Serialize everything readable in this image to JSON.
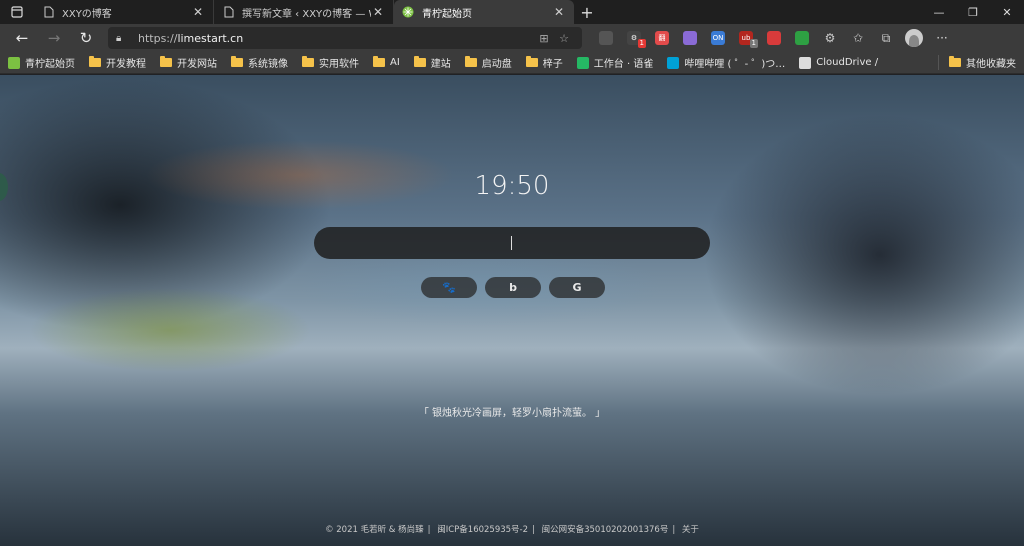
{
  "tabs": [
    {
      "title": "XXYの博客",
      "active": false
    },
    {
      "title": "撰写新文章 ‹ XXYの博客 — Wor…",
      "active": false
    },
    {
      "title": "青柠起始页",
      "active": true
    }
  ],
  "address": {
    "scheme": "https://",
    "host": "limestart.cn"
  },
  "extensions": [
    {
      "name": "reader-icon",
      "color": "#555555",
      "label": "",
      "badge": ""
    },
    {
      "name": "ext-icon-1",
      "color": "#444444",
      "label": "⚙",
      "badge": "1"
    },
    {
      "name": "ext-icon-2",
      "color": "#e24b4b",
      "label": "翻",
      "badge": ""
    },
    {
      "name": "ext-icon-3",
      "color": "#8a6bd6",
      "label": "",
      "badge": ""
    },
    {
      "name": "ext-icon-4",
      "color": "#3a7bd5",
      "label": "ON",
      "badge": ""
    },
    {
      "name": "ext-icon-5",
      "color": "#b3261e",
      "label": "ub",
      "badge": "1"
    },
    {
      "name": "ext-icon-6",
      "color": "#d83b3b",
      "label": "",
      "badge": ""
    },
    {
      "name": "ext-icon-7",
      "color": "#2ea043",
      "label": "",
      "badge": ""
    }
  ],
  "bookmarks": [
    {
      "label": "青柠起始页",
      "type": "site",
      "color": "#7cc142"
    },
    {
      "label": "开发教程",
      "type": "folder"
    },
    {
      "label": "开发网站",
      "type": "folder"
    },
    {
      "label": "系统镜像",
      "type": "folder"
    },
    {
      "label": "实用软件",
      "type": "folder"
    },
    {
      "label": "AI",
      "type": "folder"
    },
    {
      "label": "建站",
      "type": "folder"
    },
    {
      "label": "启动盘",
      "type": "folder"
    },
    {
      "label": "梓子",
      "type": "folder"
    },
    {
      "label": "工作台 · 语雀",
      "type": "site",
      "color": "#25b864"
    },
    {
      "label": "哔哩哔哩 ( ゜- ゜)つ…",
      "type": "site",
      "color": "#00a1d6"
    },
    {
      "label": "CloudDrive /",
      "type": "site",
      "color": "#dddddd"
    }
  ],
  "other_bookmarks": "其他收藏夹",
  "clock": "19:50",
  "engines": [
    {
      "name": "baidu-icon",
      "glyph": "🐾"
    },
    {
      "name": "bing-icon",
      "glyph": "b"
    },
    {
      "name": "google-icon",
      "glyph": "G"
    }
  ],
  "quote": "「 银烛秋光冷画屏，轻罗小扇扑流萤。 」",
  "footer": {
    "copyright": "© 2021 毛若昕 & 杨尚臻",
    "icp": "闽ICP备16025935号-2",
    "police": "闽公网安备35010202001376号",
    "about": "关于"
  }
}
